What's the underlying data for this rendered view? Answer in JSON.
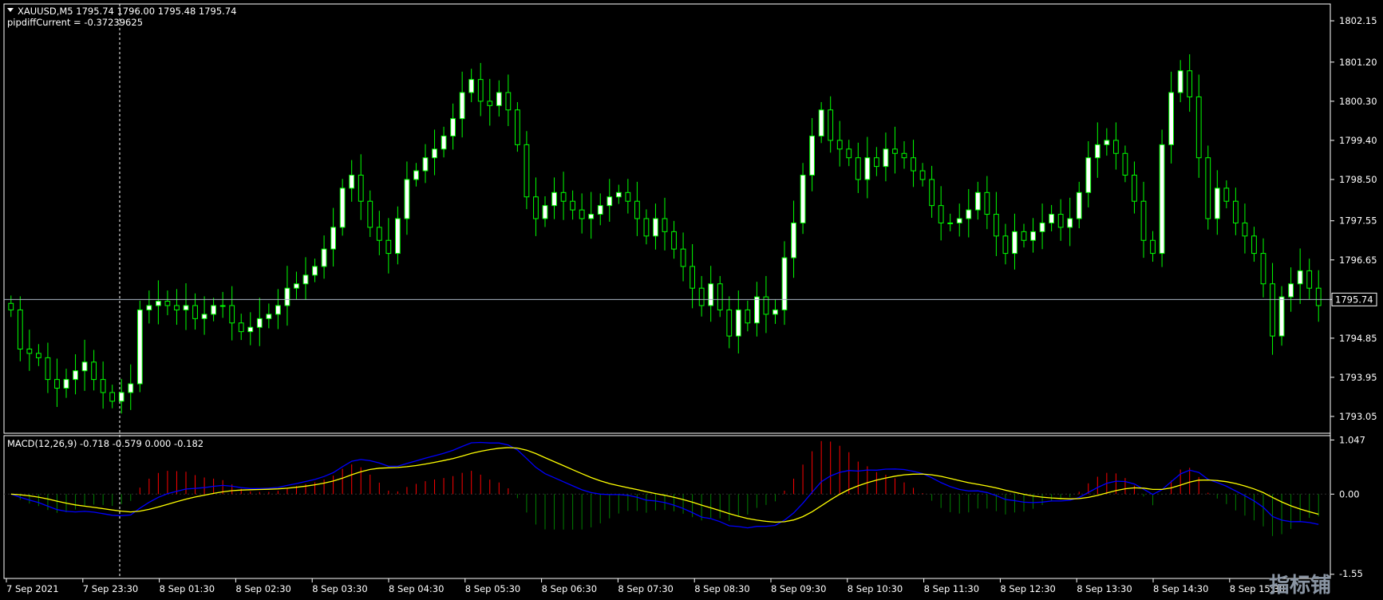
{
  "header": {
    "symbol_line": "XAUUSD,M5  1795.74 1796.00 1795.48 1795.74",
    "info_line": "pipdiffCurrent = -0.37239625"
  },
  "macd": {
    "label": "MACD(12,26,9) -0.718 -0.579 0.000 -0.182"
  },
  "price_axis": {
    "ticks": [
      "1802.15",
      "1801.20",
      "1800.30",
      "1799.40",
      "1798.50",
      "1797.55",
      "1796.65",
      "1795.74",
      "1794.85",
      "1793.95",
      "1793.05"
    ],
    "current_price": "1795.74"
  },
  "macd_axis": {
    "ticks": [
      "1.047",
      "0.00",
      "-1.55"
    ]
  },
  "time_axis": {
    "labels": [
      "7 Sep 2021",
      "7 Sep 23:30",
      "8 Sep 01:30",
      "8 Sep 02:30",
      "8 Sep 03:30",
      "8 Sep 04:30",
      "8 Sep 05:30",
      "8 Sep 06:30",
      "8 Sep 07:30",
      "8 Sep 08:30",
      "8 Sep 09:30",
      "8 Sep 10:30",
      "8 Sep 11:30",
      "8 Sep 12:30",
      "8 Sep 13:30",
      "8 Sep 14:30",
      "8 Sep 15:30"
    ]
  },
  "watermark": "指标铺",
  "colors": {
    "background": "#000000",
    "candle": "#00ff00",
    "bull_body": "#ffffff",
    "price_line": "#a9b4c2",
    "macd_main": "#0000ff",
    "macd_signal": "#ffff00",
    "hist_pos": "#ff0000",
    "hist_neg": "#008000",
    "grid_frame": "#ffffff"
  },
  "chart_data": [
    {
      "type": "candlestick",
      "title": "XAUUSD,M5",
      "ylim": [
        1792.7,
        1802.5
      ],
      "y_ticks": [
        1802.15,
        1801.2,
        1800.3,
        1799.4,
        1798.5,
        1797.55,
        1796.65,
        1795.74,
        1794.85,
        1793.95,
        1793.05
      ],
      "current_price": 1795.74,
      "closes": [
        1795.5,
        1794.6,
        1794.5,
        1794.4,
        1793.9,
        1793.7,
        1793.9,
        1794.1,
        1794.3,
        1793.9,
        1793.6,
        1793.4,
        1793.6,
        1793.8,
        1795.5,
        1795.6,
        1795.7,
        1795.6,
        1795.5,
        1795.6,
        1795.3,
        1795.4,
        1795.6,
        1795.6,
        1795.2,
        1795.0,
        1795.1,
        1795.3,
        1795.4,
        1795.6,
        1796.0,
        1796.1,
        1796.3,
        1796.5,
        1796.9,
        1797.4,
        1798.3,
        1798.6,
        1798.0,
        1797.4,
        1797.1,
        1796.8,
        1797.6,
        1798.5,
        1798.7,
        1799.0,
        1799.2,
        1799.5,
        1799.9,
        1800.5,
        1800.8,
        1800.3,
        1800.2,
        1800.5,
        1800.1,
        1799.3,
        1798.1,
        1797.6,
        1797.9,
        1798.2,
        1798.0,
        1797.8,
        1797.6,
        1797.7,
        1797.9,
        1798.1,
        1798.2,
        1798.0,
        1797.6,
        1797.2,
        1797.6,
        1797.3,
        1796.9,
        1796.5,
        1796.0,
        1795.6,
        1796.1,
        1795.5,
        1794.9,
        1795.5,
        1795.2,
        1795.8,
        1795.4,
        1795.5,
        1796.7,
        1797.5,
        1798.6,
        1799.5,
        1800.1,
        1799.4,
        1799.2,
        1799.0,
        1798.5,
        1799.0,
        1798.8,
        1799.2,
        1799.1,
        1799.0,
        1798.7,
        1798.5,
        1797.9,
        1797.5,
        1797.5,
        1797.6,
        1797.8,
        1798.2,
        1797.7,
        1797.2,
        1796.8,
        1797.3,
        1797.1,
        1797.3,
        1797.5,
        1797.7,
        1797.4,
        1797.6,
        1798.2,
        1799.0,
        1799.3,
        1799.4,
        1799.1,
        1798.6,
        1798.0,
        1797.1,
        1796.8,
        1799.3,
        1800.5,
        1801.0,
        1800.4,
        1799.0,
        1797.6,
        1798.3,
        1798.0,
        1797.5,
        1797.2,
        1796.8,
        1796.1,
        1794.9,
        1795.8,
        1796.1,
        1796.4,
        1796.0,
        1795.6
      ]
    },
    {
      "type": "macd",
      "title": "MACD(12,26,9)",
      "values": {
        "main": -0.718,
        "signal": -0.579,
        "level": 0.0,
        "histogram": -0.182
      },
      "ylim": [
        -1.6,
        1.1
      ],
      "y_ticks": [
        1.047,
        0.0,
        -1.55
      ]
    }
  ]
}
